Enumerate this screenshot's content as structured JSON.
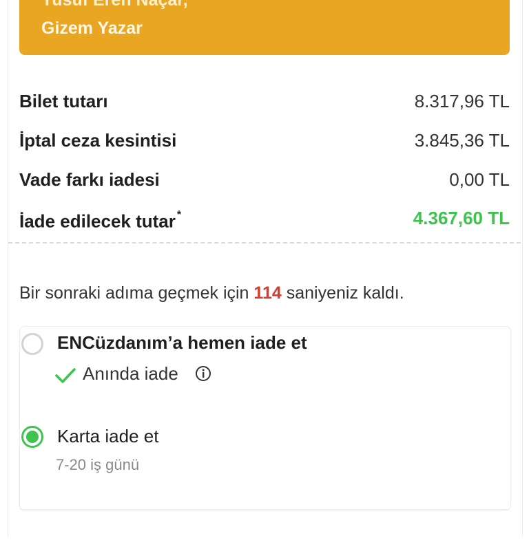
{
  "passengers": {
    "line1": "Yusuf Eren Naçar,",
    "line2": "Gizem Yazar"
  },
  "summary": [
    {
      "label": "Bilet tutarı",
      "value": "8.317,96 TL"
    },
    {
      "label": "İptal ceza kesintisi",
      "value": "3.845,36 TL"
    },
    {
      "label": "Vade farkı iadesi",
      "value": "0,00 TL"
    },
    {
      "label": "İade edilecek tutar",
      "value": "4.367,60 TL",
      "note_mark": "*"
    }
  ],
  "countdown": {
    "prefix": "Bir sonraki adıma geçmek için",
    "seconds": "114",
    "suffix": "saniyeniz kaldı."
  },
  "refund_options": [
    {
      "title": "ENCüzdanım’a hemen iade et",
      "badge": "Anında iade",
      "selected": false
    },
    {
      "title": "Karta iade et",
      "subtitle": "7-20 iş günü",
      "selected": true
    }
  ],
  "colors": {
    "banner": "#e8a623",
    "green": "#3ec34f",
    "red": "#d83a2c"
  },
  "icons": {
    "check": "check-icon",
    "info": "info-icon"
  }
}
